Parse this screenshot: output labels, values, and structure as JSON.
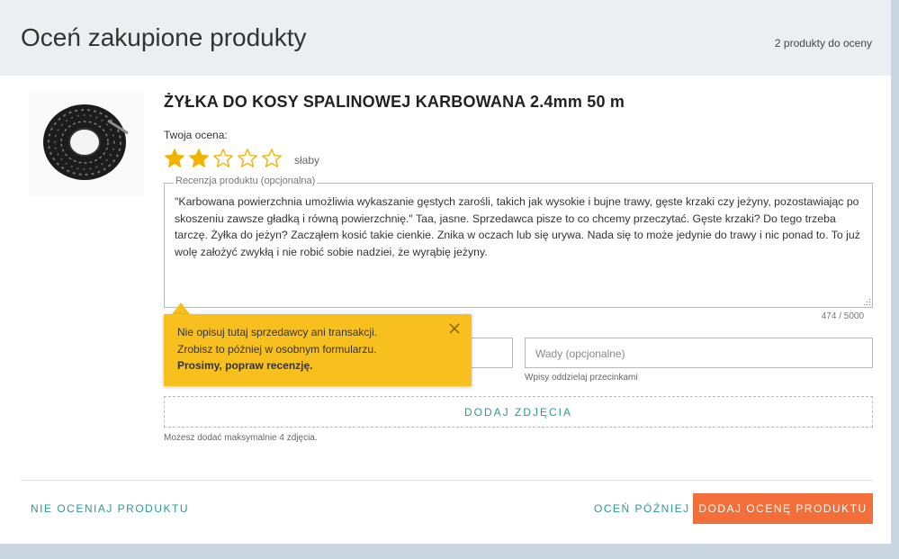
{
  "header": {
    "title": "Oceń zakupione produkty",
    "products_count": "2 produkty do oceny"
  },
  "product": {
    "name": "ŻYŁKA DO KOSY SPALINOWEJ KARBOWANA 2.4mm 50 m"
  },
  "rating": {
    "label": "Twoja ocena:",
    "value": 2,
    "max": 5,
    "word": "słaby",
    "filled_color": "#f0b400",
    "empty_color": "#f0b400"
  },
  "review": {
    "legend": "Recenzja produktu (opcjonalna)",
    "text": "\"Karbowana powierzchnia umożliwia wykaszanie gęstych zarośli, takich jak wysokie i bujne trawy, gęste krzaki czy jeżyny, pozostawiając po skoszeniu zawsze gładką i równą powierzchnię.\" Taa, jasne. Sprzedawca pisze to co chcemy przeczytać. Gęste krzaki? Do tego trzeba tarczę. Żyłka do jeżyn? Zacząłem kosić takie cienkie. Znika w oczach lub się urywa. Nada się to może jedynie do trawy i nic ponad to. To już wolę założyć zwykłą i nie robić sobie nadziei, że wyrąbię jeżyny.",
    "char_count": "474 / 5000"
  },
  "pros_field": {
    "placeholder": ""
  },
  "cons_field": {
    "placeholder": "Wady (opcjonalne)",
    "hint": "Wpisy oddzielaj przecinkami"
  },
  "photos": {
    "button_label": "DODAJ ZDJĘCIA",
    "hint": "Możesz dodać maksymalnie 4 zdjęcia."
  },
  "tooltip": {
    "line1": "Nie opisuj tutaj sprzedawcy ani transakcji.",
    "line2": "Zrobisz to później w osobnym formularzu.",
    "line3": "Prosimy, popraw recenzję."
  },
  "footer": {
    "skip_label": "NIE OCENIAJ PRODUKTU",
    "later_label": "OCEŃ PÓŹNIEJ",
    "submit_label": "DODAJ OCENĘ PRODUKTU",
    "submit_color": "#f26e3b",
    "link_color": "#2a9898"
  }
}
